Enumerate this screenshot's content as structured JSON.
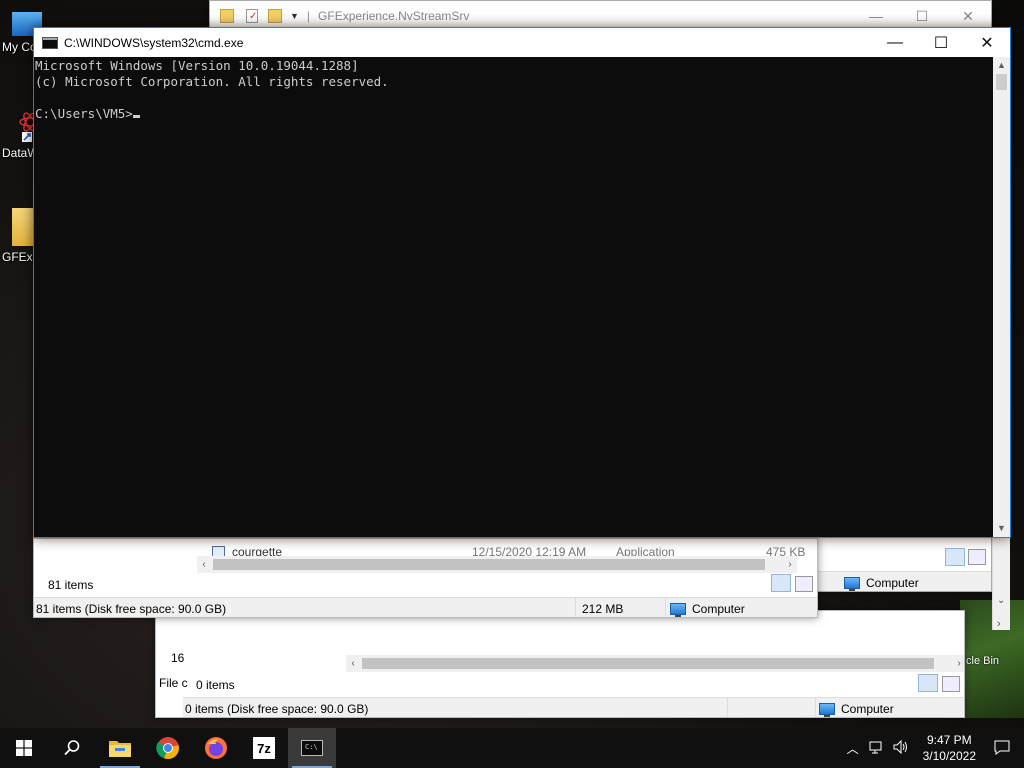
{
  "desktop": {
    "icons": [
      {
        "label": "My Co"
      },
      {
        "label": "DataW"
      },
      {
        "label": "GFExp"
      }
    ],
    "recycle_bin_label": "cle Bin"
  },
  "explorer_back": {
    "title": "GFExperience.NvStreamSrv",
    "status_computer": "Computer"
  },
  "explorer_middle": {
    "file_row": {
      "name": "courgette",
      "date": "12/15/2020 12:19 AM",
      "type": "Application",
      "size": "475 KB"
    },
    "items_count": "81 items",
    "status_left": "81 items (Disk free space: 90.0 GB)",
    "status_size": "212 MB",
    "status_computer": "Computer"
  },
  "explorer_front": {
    "left_fragment_1": "16",
    "left_fragment_2": "File c",
    "items_count": "0 items",
    "status_left": "0 items (Disk free space: 90.0 GB)",
    "status_computer": "Computer"
  },
  "cmd": {
    "title": "C:\\WINDOWS\\system32\\cmd.exe",
    "lines": [
      "Microsoft Windows [Version 10.0.19044.1288]",
      "(c) Microsoft Corporation. All rights reserved.",
      "",
      "C:\\Users\\VM5>"
    ]
  },
  "taskbar": {
    "apps": [
      {
        "icon": "windows-start-icon"
      },
      {
        "icon": "search-icon"
      },
      {
        "icon": "file-explorer-icon"
      },
      {
        "icon": "chrome-icon"
      },
      {
        "icon": "firefox-icon"
      },
      {
        "icon": "7zip-icon",
        "label": "7z"
      },
      {
        "icon": "cmd-icon"
      }
    ],
    "time": "9:47 PM",
    "date": "3/10/2022"
  },
  "colors": {
    "console_bg": "#0c0c0c",
    "console_text": "#cccccc",
    "accent_border": "#1883d7",
    "taskbar_bg": "#101010"
  }
}
